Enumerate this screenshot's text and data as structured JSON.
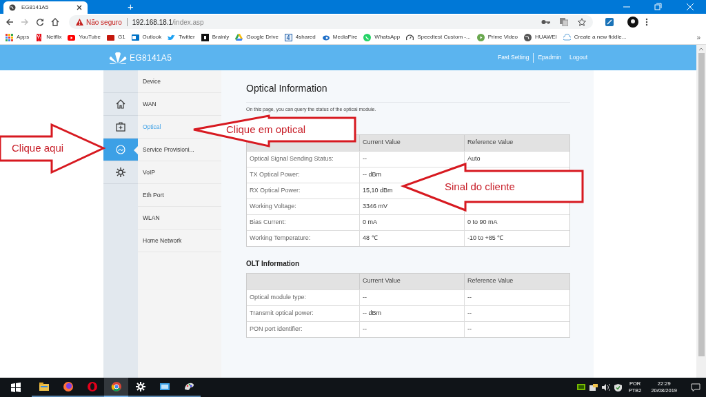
{
  "browser": {
    "tab_title": "EG8141A5",
    "new_tab": "+",
    "address": {
      "warning": "Não seguro",
      "host": "192.168.18.1",
      "path": "/index.asp"
    },
    "bookmarks": [
      "Apps",
      "Netflix",
      "YouTube",
      "G1",
      "Outlook",
      "Twitter",
      "Brainly",
      "Google Drive",
      "4shared",
      "MediaFire",
      "WhatsApp",
      "Speedtest Custom -...",
      "Prime Video",
      "HUAWEI",
      "Create a new fiddle..."
    ],
    "more": "»"
  },
  "header": {
    "model": "EG8141A5",
    "links": [
      "Fast Setting",
      "Epadmin",
      "Logout"
    ]
  },
  "nav_icons": [
    {
      "selected": false
    },
    {
      "selected": false
    },
    {
      "selected": true
    },
    {
      "selected": false
    }
  ],
  "menu": [
    {
      "label": "Device",
      "selected": false
    },
    {
      "label": "WAN",
      "selected": false
    },
    {
      "label": "Optical",
      "selected": true
    },
    {
      "label": "Service Provisioni...",
      "selected": false
    },
    {
      "label": "VoIP",
      "selected": false
    },
    {
      "label": "Eth Port",
      "selected": false
    },
    {
      "label": "WLAN",
      "selected": false
    },
    {
      "label": "Home Network",
      "selected": false
    }
  ],
  "content": {
    "title": "Optical Information",
    "description": "On this page, you can query the status of the optical module.",
    "optical_table": {
      "columns": [
        "",
        "Current Value",
        "Reference Value"
      ],
      "rows": [
        {
          "cells": [
            "Optical Signal Sending Status:",
            "--",
            "Auto"
          ]
        },
        {
          "cells": [
            "TX Optical Power:",
            "-- dBm"
          ]
        },
        {
          "cells": [
            "RX Optical Power:",
            "15,10 dBm"
          ]
        },
        {
          "cells": [
            "Working Voltage:",
            "3346 mV"
          ]
        },
        {
          "cells": [
            "Bias Current:",
            "0 mA",
            "0 to 90 mA"
          ]
        },
        {
          "cells": [
            "Working Temperature:",
            "48 ℃",
            "-10 to +85 ℃"
          ]
        }
      ]
    },
    "olt_title": "OLT Information",
    "olt_table": {
      "columns": [
        "",
        "Current Value",
        "Reference Value"
      ],
      "rows": [
        {
          "cells": [
            "Optical module type:",
            "--",
            "--"
          ]
        },
        {
          "cells": [
            "Transmit optical power:",
            "-- dBm",
            "--"
          ]
        },
        {
          "cells": [
            "PON port identifier:",
            "--",
            "--"
          ]
        }
      ]
    }
  },
  "annotations": [
    {
      "text": "Clique aqui"
    },
    {
      "text": "Clique em optical"
    },
    {
      "text": "Sinal do cliente"
    }
  ],
  "taskbar": {
    "apps": [
      {
        "selected": false
      },
      {
        "selected": false
      },
      {
        "selected": false
      },
      {
        "selected": true
      },
      {
        "selected": false
      },
      {
        "selected": false
      },
      {
        "selected": false
      }
    ],
    "language": "POR",
    "layout": "PTB2",
    "time": "22:29",
    "date": "20/08/2019"
  }
}
